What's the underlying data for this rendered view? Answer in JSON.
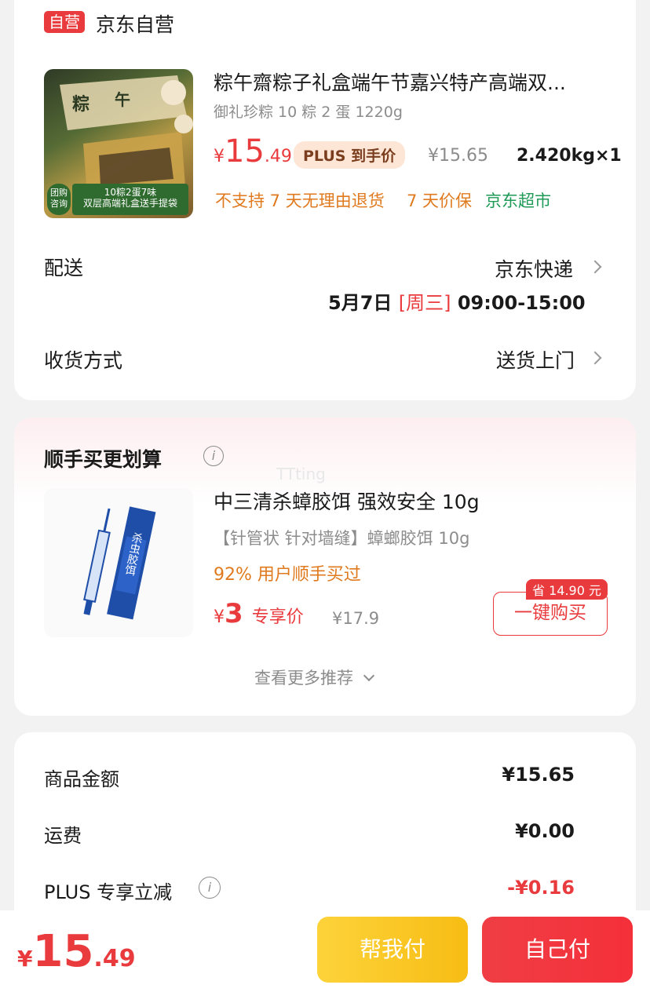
{
  "shop": {
    "badge": "自营",
    "name": "京东自营"
  },
  "product": {
    "title": "粽午齋粽子礼盒端午节嘉兴特产高端双...",
    "spec": "御礼珍粽 10 粽 2 蛋 1220g",
    "price_symbol": "¥",
    "price_int": "15",
    "price_dec": ".49",
    "plus_tag": "PLUS 到手价",
    "orig_price": "¥15.65",
    "weight_qty": "2.420kg×1",
    "tags": [
      "不支持 7 天无理由退货",
      "7 天价保"
    ],
    "store_tag": "京东超市",
    "image_texts": {
      "consult": "团购咨询",
      "line1": "10粽2蛋7味",
      "line2": "双层高端礼盒送手提袋"
    }
  },
  "delivery": {
    "label": "配送",
    "carrier": "京东快递",
    "date": "5月7日",
    "weekday": "[周三]",
    "time": "09:00-15:00"
  },
  "receive": {
    "label": "收货方式",
    "value": "送货上门"
  },
  "recommend": {
    "section_title": "顺手买更划算",
    "watermark": "TTting",
    "item": {
      "title": "中三清杀蟑胶饵 强效安全 10g",
      "desc": "【针管状 针对墙缝】蟑螂胶饵 10g",
      "stat": "92% 用户顺手买过",
      "price_symbol": "¥",
      "price": "3",
      "price_label": "专享价",
      "orig_price": "¥17.9",
      "save_badge": "省 14.90 元",
      "buy_button": "一键购买",
      "img_label": "杀虫胶饵"
    },
    "more": "查看更多推荐"
  },
  "summary": {
    "rows": [
      {
        "label": "商品金额",
        "value": "¥15.65"
      },
      {
        "label": "运费",
        "value": "¥0.00"
      },
      {
        "label": "PLUS 专享立减",
        "value": "-¥0.16"
      }
    ]
  },
  "footer": {
    "price_symbol": "¥",
    "price_int": "15",
    "price_dec": ".49",
    "help_pay": "帮我付",
    "self_pay": "自己付"
  },
  "colors": {
    "accent_red": "#e93b3d",
    "orange_tag": "#e07a1f",
    "green_tag": "#1f9a57",
    "pay_yellow": "#f7bd14"
  },
  "icons": {
    "info": "info-icon",
    "chevron": "chevron-right-icon",
    "chevron_down": "chevron-down-icon"
  }
}
